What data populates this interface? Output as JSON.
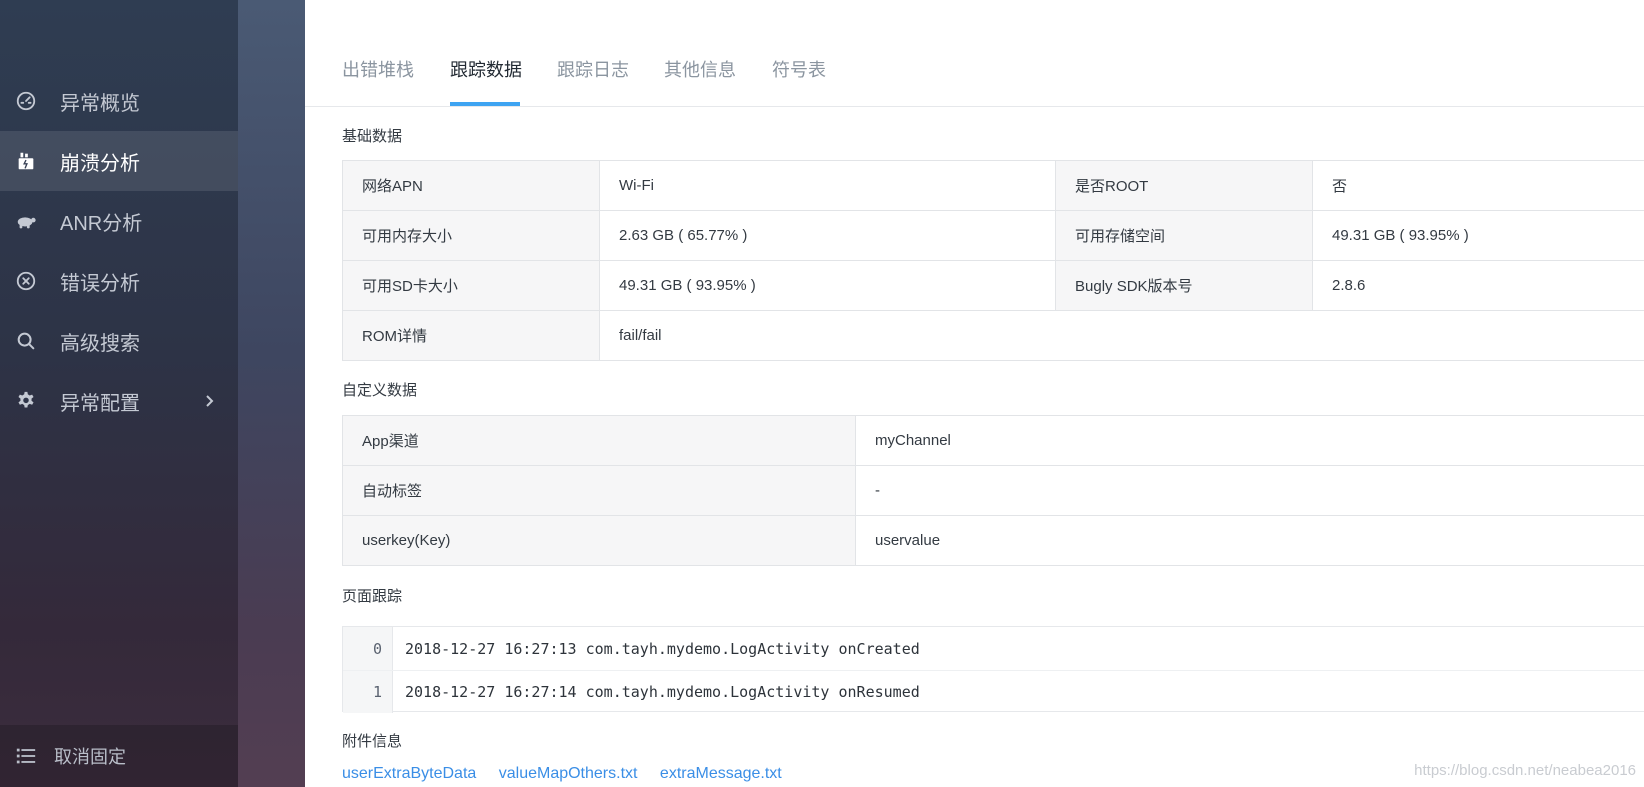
{
  "sidebar": {
    "items": [
      {
        "label": "异常概览",
        "icon": "dashboard-icon",
        "active": false
      },
      {
        "label": "崩溃分析",
        "icon": "crash-icon",
        "active": true
      },
      {
        "label": "ANR分析",
        "icon": "turtle-icon",
        "active": false
      },
      {
        "label": "错误分析",
        "icon": "error-circle-icon",
        "active": false
      },
      {
        "label": "高级搜索",
        "icon": "search-icon",
        "active": false
      },
      {
        "label": "异常配置",
        "icon": "gear-icon",
        "active": false,
        "has_submenu": true
      }
    ],
    "footer_label": "取消固定"
  },
  "tabs": [
    {
      "label": "出错堆栈",
      "active": false
    },
    {
      "label": "跟踪数据",
      "active": true
    },
    {
      "label": "跟踪日志",
      "active": false
    },
    {
      "label": "其他信息",
      "active": false
    },
    {
      "label": "符号表",
      "active": false
    }
  ],
  "basic": {
    "title": "基础数据",
    "rows": [
      [
        "网络APN",
        "Wi-Fi",
        "是否ROOT",
        "否"
      ],
      [
        "可用内存大小",
        "2.63 GB ( 65.77% )",
        "可用存储空间",
        "49.31 GB ( 93.95% )"
      ],
      [
        "可用SD卡大小",
        "49.31 GB ( 93.95% )",
        "Bugly SDK版本号",
        "2.8.6"
      ],
      [
        "ROM详情",
        "fail/fail"
      ]
    ]
  },
  "custom": {
    "title": "自定义数据",
    "rows": [
      [
        "App渠道",
        "myChannel"
      ],
      [
        "自动标签",
        "-"
      ],
      [
        "userkey(Key)",
        "uservalue"
      ]
    ]
  },
  "page_trace": {
    "title": "页面跟踪",
    "lines": [
      {
        "num": "0",
        "text": "2018-12-27 16:27:13 com.tayh.mydemo.LogActivity onCreated"
      },
      {
        "num": "1",
        "text": "2018-12-27 16:27:14 com.tayh.mydemo.LogActivity onResumed"
      }
    ]
  },
  "attachments": {
    "title": "附件信息",
    "files": [
      "userExtraByteData",
      "valueMapOthers.txt",
      "extraMessage.txt"
    ]
  },
  "watermark": "https://blog.csdn.net/neabea2016",
  "colors": {
    "accent": "#3ea4f2",
    "link": "#3a8ee6"
  }
}
